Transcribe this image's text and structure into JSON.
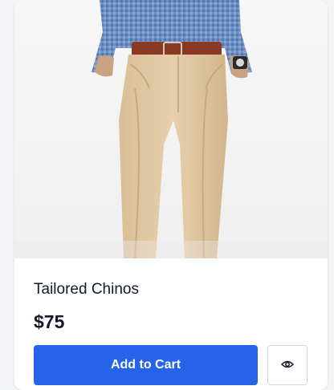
{
  "product": {
    "image_alt": "Person wearing beige chinos with a blue checked shirt and brown belt",
    "name": "Tailored Chinos",
    "price": "$75"
  },
  "actions": {
    "add_to_cart_label": "Add to Cart",
    "quick_view_icon": "eye-icon"
  },
  "colors": {
    "primary": "#2563eb",
    "text": "#111827",
    "border": "#d1d5db"
  }
}
